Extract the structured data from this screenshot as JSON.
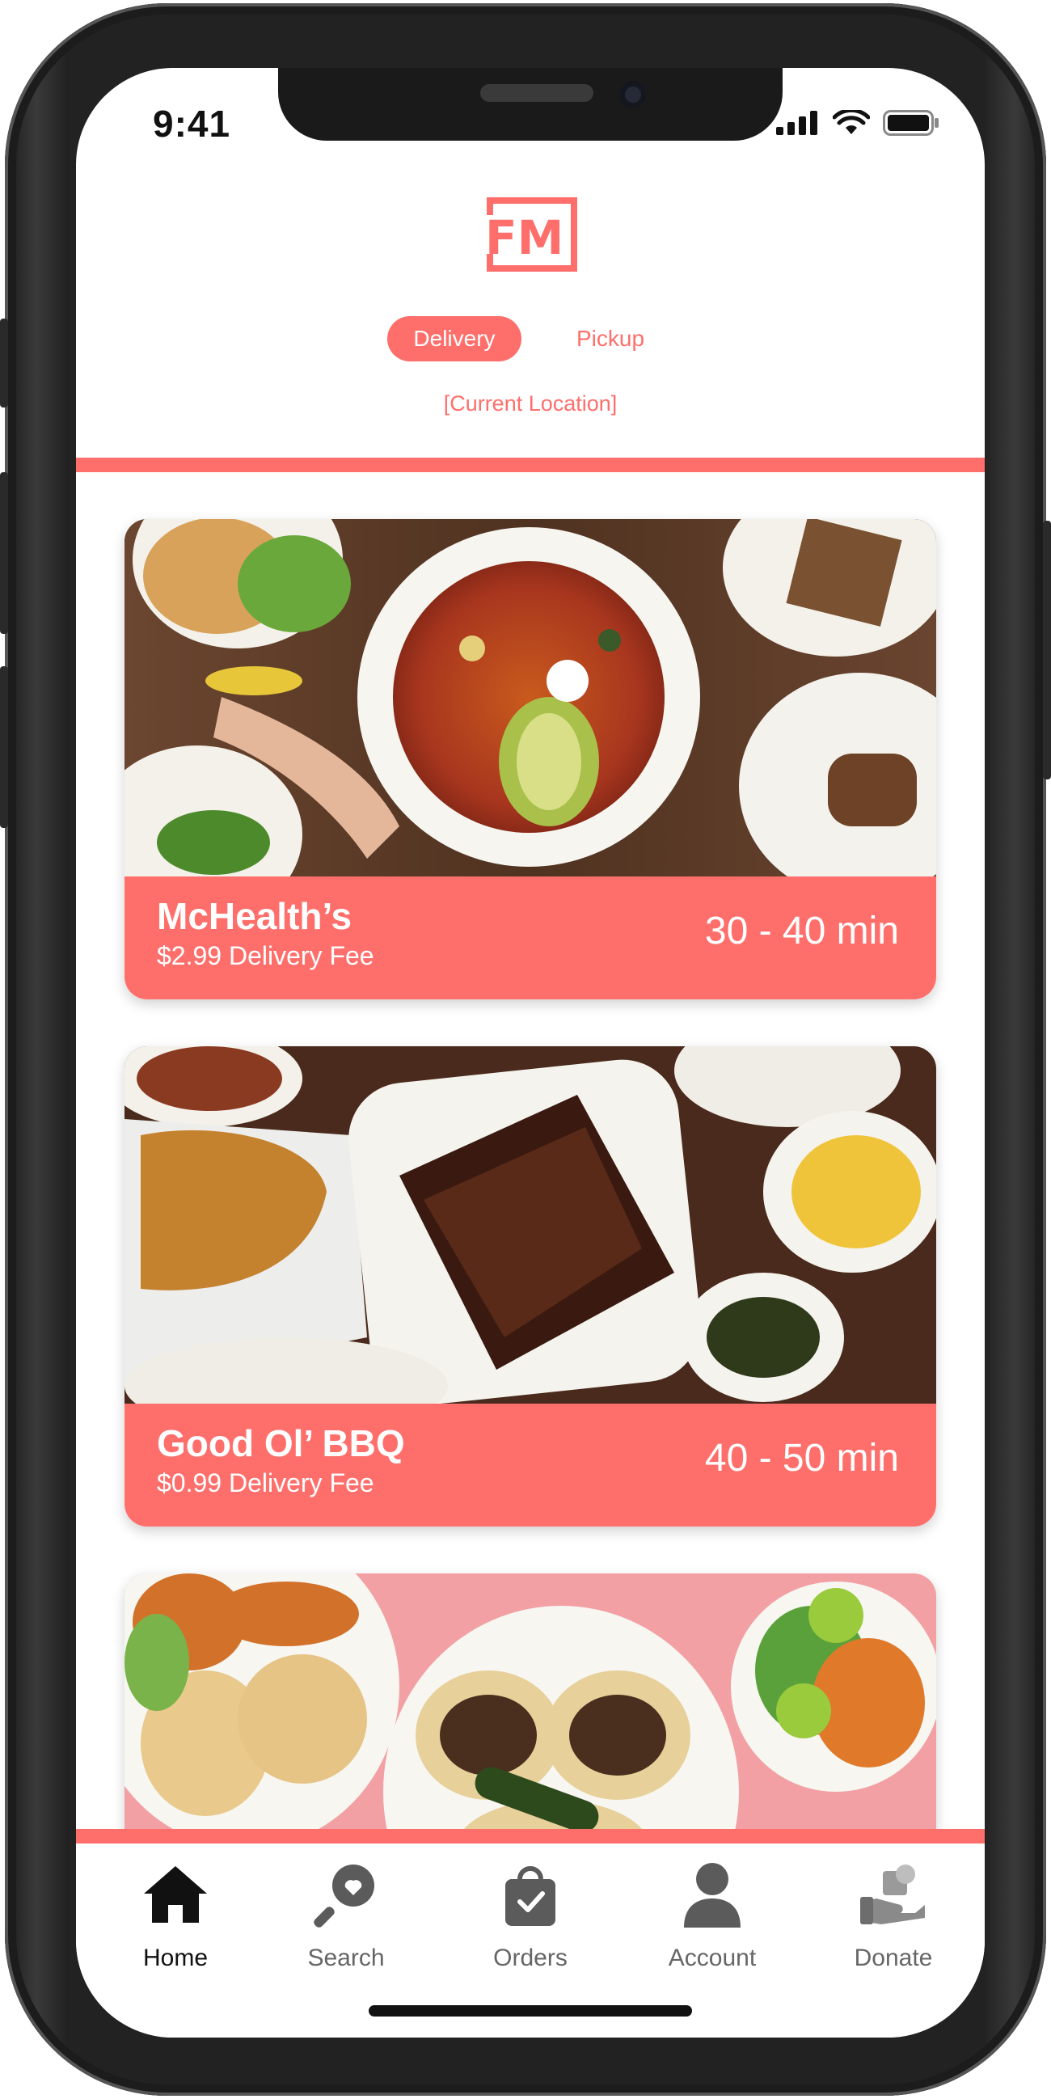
{
  "status_bar": {
    "time": "9:41"
  },
  "header": {
    "logo_text": "FM",
    "modes": {
      "active": "Delivery",
      "inactive": "Pickup"
    },
    "location": "[Current Location]"
  },
  "colors": {
    "accent": "#fe6f6c",
    "tab_active": "#111111",
    "tab_inactive": "#666666"
  },
  "restaurants": [
    {
      "name": "McHealth’s",
      "fee": "$2.99 Delivery Fee",
      "eta": "30 - 40 min"
    },
    {
      "name": "Good Ol’ BBQ",
      "fee": "$0.99 Delivery Fee",
      "eta": "40 - 50 min"
    }
  ],
  "tabbar": [
    {
      "label": "Home",
      "icon": "home-icon",
      "active": true
    },
    {
      "label": "Search",
      "icon": "search-heart-icon",
      "active": false
    },
    {
      "label": "Orders",
      "icon": "shopping-bag-icon",
      "active": false
    },
    {
      "label": "Account",
      "icon": "person-icon",
      "active": false
    },
    {
      "label": "Donate",
      "icon": "donate-hand-icon",
      "active": false
    }
  ]
}
